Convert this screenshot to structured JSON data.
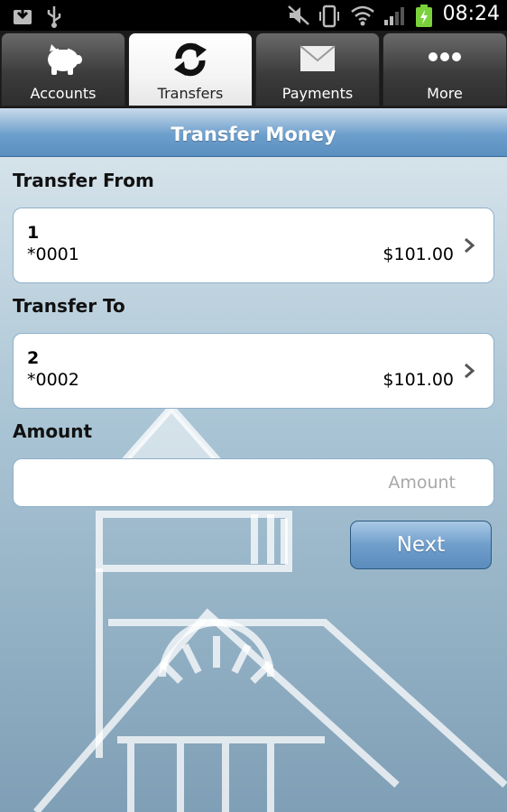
{
  "status_bar": {
    "time": "08:24",
    "icons": [
      "download-icon",
      "usb-icon",
      "mute-icon",
      "vibrate-icon",
      "wifi-icon",
      "signal-icon",
      "battery-charging-icon"
    ],
    "battery_color": "#7bd13b"
  },
  "tabs": [
    {
      "label": "Accounts",
      "icon": "piggy-bank-icon",
      "active": false
    },
    {
      "label": "Transfers",
      "icon": "transfer-arrows-icon",
      "active": true
    },
    {
      "label": "Payments",
      "icon": "envelope-icon",
      "active": false
    },
    {
      "label": "More",
      "icon": "more-dots-icon",
      "active": false
    }
  ],
  "page": {
    "title": "Transfer Money"
  },
  "transfer_from": {
    "label": "Transfer From",
    "account": {
      "name": "1",
      "number": "*0001",
      "balance": "$101.00"
    }
  },
  "transfer_to": {
    "label": "Transfer To",
    "account": {
      "name": "2",
      "number": "*0002",
      "balance": "$101.00"
    }
  },
  "amount": {
    "label": "Amount",
    "value": "",
    "placeholder": "Amount"
  },
  "actions": {
    "next_label": "Next"
  },
  "colors": {
    "accent": "#6d9fcc",
    "title_text": "#ffffff",
    "card_border": "#8fb0c8"
  }
}
